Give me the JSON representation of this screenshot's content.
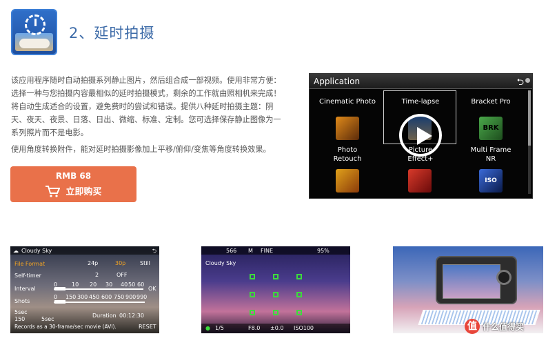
{
  "header": {
    "title": "2、延时拍摄"
  },
  "description": {
    "lines": [
      "该应用程序随时自动拍摄系列静止图片，然后组合成一部视频。使用非常方便：",
      "选择一种与您拍摄内容最相似的延时拍摄模式，剩余的工作就由照相机来完成！",
      "将自动生成适合的设置，避免费时的尝试和错误。提供八种延时拍摄主题：阴",
      "天、夜天、夜景、日落、日出、微缩、标准、定制。您可选择保存静止图像为一",
      "系列照片而不是电影。"
    ],
    "accessory": "使用角度转换附件，能对延时拍摄影像加上平移/俯仰/变焦等角度转换效果。"
  },
  "buy": {
    "price": "RMB 68",
    "label": "立即购买"
  },
  "app_menu": {
    "title": "Application",
    "items": [
      {
        "label": "Cinematic Photo"
      },
      {
        "label": "Time-lapse"
      },
      {
        "label": "Bracket Pro"
      },
      {
        "label": "Photo Retouch",
        "line1": "Photo",
        "line2": "Retouch"
      },
      {
        "label": "Picture Effect+",
        "line1": "Picture",
        "line2": "Effect+"
      },
      {
        "label": "Multi Frame NR",
        "line1": "Multi Frame",
        "line2": "NR"
      }
    ],
    "icon_texts": {
      "bracket": "BRK",
      "multi": "ISO"
    }
  },
  "shot1": {
    "theme": "Cloudy Sky",
    "file_format": "File Format",
    "fps_24": "24p",
    "fps_30": "30p",
    "still": "Still",
    "self_timer": "Self-timer",
    "self_timer_values": [
      "2",
      "OFF"
    ],
    "interval": "Interval",
    "interval_ticks": [
      "0",
      "10",
      "20",
      "30",
      "40",
      "50",
      "60"
    ],
    "shots": "Shots",
    "shots_ticks": [
      "0",
      "150",
      "300",
      "450",
      "600",
      "750",
      "900",
      "990"
    ],
    "ok": "OK",
    "interval_value": "5sec",
    "shots_value": "150",
    "secondary_value": "5sec",
    "duration_label": "Duration",
    "duration_value": "00:12:30",
    "footer": "Records as a 30-frame/sec movie (AVI).",
    "reset": "RESET"
  },
  "shot2": {
    "shots": "566",
    "size": "M",
    "quality": "FINE",
    "battery": "95%",
    "theme": "Cloudy Sky",
    "count": "1/5",
    "aperture": "F8.0",
    "ev": "±0.0",
    "iso": "ISO100"
  },
  "watermark": {
    "logo": "值",
    "text": "什么值得买"
  }
}
